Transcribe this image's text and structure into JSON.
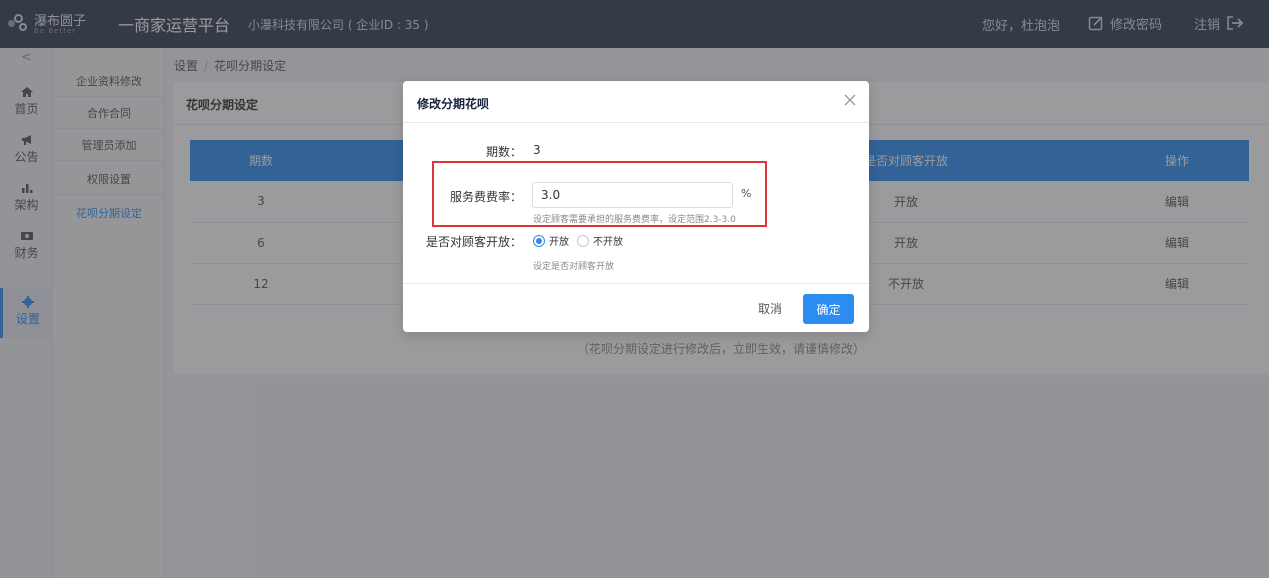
{
  "header": {
    "brand_cn": "瀑布圆子",
    "brand_en": "Be Better",
    "platform_title": "一商家运营平台",
    "company": "小瀑科技有限公司 ( 企业ID : 35 )",
    "greeting": "您好，杜泡泡",
    "edit_password": "修改密码",
    "logout": "注销"
  },
  "sidebar": {
    "collapse_icon": "chevron-left",
    "items": [
      {
        "label": "首页",
        "icon": "home-icon"
      },
      {
        "label": "公告",
        "icon": "megaphone-icon"
      },
      {
        "label": "架构",
        "icon": "org-chart-icon"
      },
      {
        "label": "财务",
        "icon": "finance-icon"
      },
      {
        "label": "设置",
        "icon": "gear-icon"
      }
    ]
  },
  "submenu": {
    "items": [
      "企业资料修改",
      "合作合同",
      "管理员添加",
      "权限设置",
      "花呗分期设定"
    ]
  },
  "breadcrumb": {
    "root": "设置",
    "current": "花呗分期设定"
  },
  "card": {
    "title": "花呗分期设定",
    "columns": [
      "期数",
      "",
      "是否对顾客开放",
      "操作"
    ],
    "rows": [
      {
        "period": "3",
        "open": "开放",
        "action": "编辑"
      },
      {
        "period": "6",
        "open": "开放",
        "action": "编辑"
      },
      {
        "period": "12",
        "open": "不开放",
        "action": "编辑"
      }
    ],
    "notice": "（花呗分期设定进行修改后，立即生效，请谨慎修改）"
  },
  "modal": {
    "title": "修改分期花呗",
    "period_label": "期数：",
    "period_value": "3",
    "rate_label": "服务费费率：",
    "rate_value": "3.0",
    "rate_unit": "%",
    "rate_hint": "设定顾客需要承担的服务费费率，设定范围2.3-3.0",
    "open_label": "是否对顾客开放：",
    "open_option_yes": "开放",
    "open_option_no": "不开放",
    "open_selected": "开放",
    "open_hint": "设定是否对顾客开放",
    "cancel": "取消",
    "ok": "确定"
  },
  "colors": {
    "header_bg": "#313e50",
    "accent": "#2d8cf0",
    "highlight": "#e0363a"
  }
}
